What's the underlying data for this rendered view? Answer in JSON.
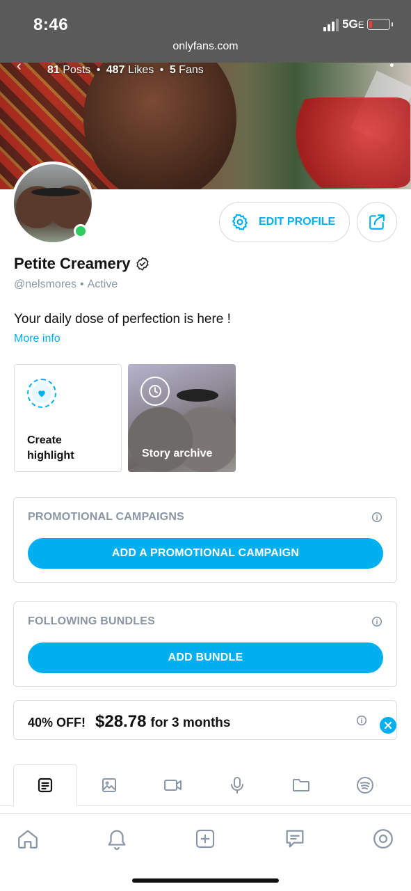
{
  "browser": {
    "time": "8:46",
    "network": "5G",
    "network_suffix": "E",
    "url": "onlyfans.com"
  },
  "profile": {
    "posts_count": "81",
    "posts_label": "Posts",
    "likes_count": "487",
    "likes_label": "Likes",
    "fans_count": "5",
    "fans_label": "Fans",
    "name": "Petite Creamery",
    "handle": "@nelsmores",
    "separator": "•",
    "status": "Active",
    "bio": "Your daily dose of perfection is here !",
    "more_info": "More info",
    "edit_profile": "EDIT PROFILE"
  },
  "highlights": {
    "create": "Create highlight",
    "archive": "Story archive"
  },
  "promotional": {
    "title": "PROMOTIONAL CAMPAIGNS",
    "button": "ADD A PROMOTIONAL CAMPAIGN"
  },
  "bundles": {
    "title": "FOLLOWING BUNDLES",
    "button": "ADD BUNDLE"
  },
  "discount": {
    "off": "40% OFF!",
    "price": "$28.78",
    "term": "for 3 months"
  },
  "tabs": [
    "posts-icon",
    "photos-icon",
    "videos-icon",
    "audio-icon",
    "folder-icon",
    "spotify-icon"
  ],
  "nav": [
    "home-icon",
    "notifications-icon",
    "add-post-icon",
    "messages-icon",
    "profile-icon"
  ],
  "colors": {
    "accent": "#00aff0",
    "online": "#2ecc5f",
    "muted": "#8a96a3",
    "status_bar": "#5a5a5a"
  }
}
